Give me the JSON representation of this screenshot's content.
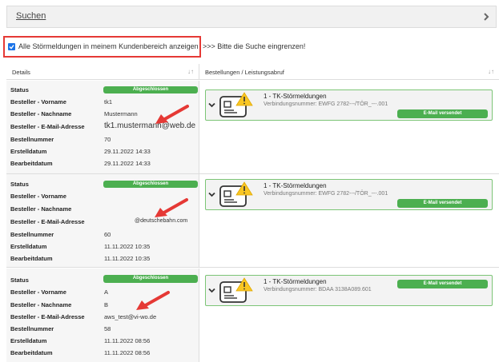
{
  "search": {
    "label": "Suchen"
  },
  "filter": {
    "checkbox_label": "Alle Störmeldungen in meinem Kundenbereich anzeigen",
    "hint": ">>> Bitte die Suche eingrenzen!",
    "checked": true
  },
  "columns": {
    "details": "Details",
    "orders": "Bestellungen / Leistungsabruf",
    "sort_glyph": "↓↑"
  },
  "field_labels": {
    "status": "Status",
    "vorname": "Besteller - Vorname",
    "nachname": "Besteller - Nachname",
    "email": "Besteller - E-Mail-Adresse",
    "bestellnummer": "Bestellnummer",
    "erstelldatum": "Erstelldatum",
    "bearbeitdatum": "Bearbeitdatum"
  },
  "records": [
    {
      "status": "Abgeschlossen",
      "vorname": "tk1",
      "nachname": "Mustermann",
      "email": "tk1.mustermann@web.de",
      "bestellnummer": "70",
      "erstelldatum": "29.11.2022 14:33",
      "bearbeitdatum": "29.11.2022 14:33",
      "order": {
        "title": "1 - TK-Störmeldungen",
        "connection": "Verbindungsnummer: EWFG 2782---/TÖR_---.001",
        "mail_status": "E-Mail versendet"
      }
    },
    {
      "status": "Abgeschlossen",
      "vorname": "",
      "nachname": "",
      "email": "@deutschebahn.com",
      "bestellnummer": "60",
      "erstelldatum": "11.11.2022 10:35",
      "bearbeitdatum": "11.11.2022 10:35",
      "order": {
        "title": "1 - TK-Störmeldungen",
        "connection": "Verbindungsnummer: EWFG 2782---/TÖR_---.001",
        "mail_status": "E-Mail versendet"
      }
    },
    {
      "status": "Abgeschlossen",
      "vorname": "A",
      "nachname": "B",
      "email": "aws_test@vi-wo.de",
      "bestellnummer": "58",
      "erstelldatum": "11.11.2022 08:56",
      "bearbeitdatum": "11.11.2022 08:56",
      "order": {
        "title": "1 - TK-Störmeldungen",
        "connection": "Verbindungsnummer: BDAA 3138A089.601",
        "mail_status": "E-Mail versendet"
      }
    }
  ],
  "colors": {
    "accent_green": "#4caf50",
    "card_border": "#7cc576",
    "highlight_red": "#e53935",
    "arrow_red": "#e53935",
    "warning_yellow": "#f9c623"
  },
  "icons": {
    "expand": "chevron-down-icon",
    "document": "document-card-icon",
    "warning": "warning-icon",
    "arrow": "annotation-arrow-icon",
    "search_chevron": "chevron-right-icon"
  }
}
